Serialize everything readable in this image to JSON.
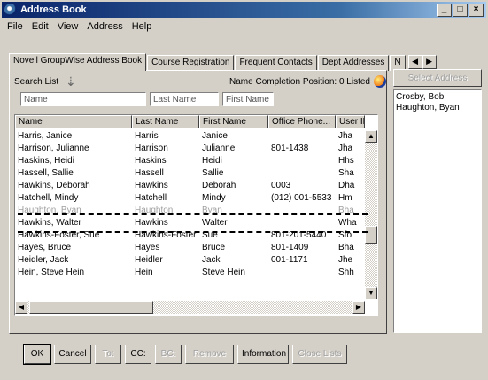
{
  "window": {
    "title": "Address Book",
    "controls": {
      "minimize": "_",
      "maximize": "□",
      "close": "×"
    }
  },
  "menu": [
    "File",
    "Edit",
    "View",
    "Address",
    "Help"
  ],
  "tabs": {
    "items": [
      "Novell GroupWise Address Book",
      "Course Registration",
      "Frequent Contacts",
      "Dept Addresses",
      "N"
    ],
    "active_index": 0
  },
  "search": {
    "label": "Search List",
    "name_completion": "Name Completion Position: 0 Listed"
  },
  "filter_fields": {
    "name": "Name",
    "last_name": "Last Name",
    "first_name": "First Name"
  },
  "list": {
    "columns": [
      "Name",
      "Last Name",
      "First Name",
      "Office Phone...",
      "User ID"
    ],
    "rows": [
      [
        "Harris, Janice",
        "Harris",
        "Janice",
        "",
        "Jha"
      ],
      [
        "Harrison, Julianne",
        "Harrison",
        "Julianne",
        "801-1438",
        "Jha"
      ],
      [
        "Haskins, Heidi",
        "Haskins",
        "Heidi",
        "",
        "Hhs"
      ],
      [
        "Hassell, Sallie",
        "Hassell",
        "Sallie",
        "",
        "Sha"
      ],
      [
        "Hawkins, Deborah",
        "Hawkins",
        "Deborah",
        "0003",
        "Dha"
      ],
      [
        "Hatchell, Mindy",
        "Hatchell",
        "Mindy",
        "(012) 001-5533",
        "Hm"
      ],
      [
        "Haughton, Byan",
        "Haughton",
        "Byan",
        "",
        "Bha"
      ],
      [
        "Hawkins, Walter",
        "Hawkins",
        "Walter",
        "",
        "Wha"
      ],
      [
        "Hawkins-Foster, Sue",
        "Hawkins-Foster",
        "Sue",
        "801-201-5440",
        "Sfo"
      ],
      [
        "Hayes, Bruce",
        "Hayes",
        "Bruce",
        "801-1409",
        "Bha"
      ],
      [
        "Heidler, Jack",
        "Heidler",
        "Jack",
        "001-1171",
        "Jhe"
      ],
      [
        "Hein, Steve Hein",
        "Hein",
        "Steve Hein",
        "",
        "Shh"
      ]
    ],
    "faded_row_index": 6
  },
  "selected_addresses": {
    "button": "Select Address",
    "items": [
      "Crosby, Bob",
      "Haughton, Byan"
    ]
  },
  "buttons": [
    "OK",
    "Cancel",
    "To:",
    "CC:",
    "BC:",
    "Remove",
    "Information",
    "Close Lists"
  ],
  "buttons_disabled": [
    2,
    4,
    5,
    7
  ]
}
